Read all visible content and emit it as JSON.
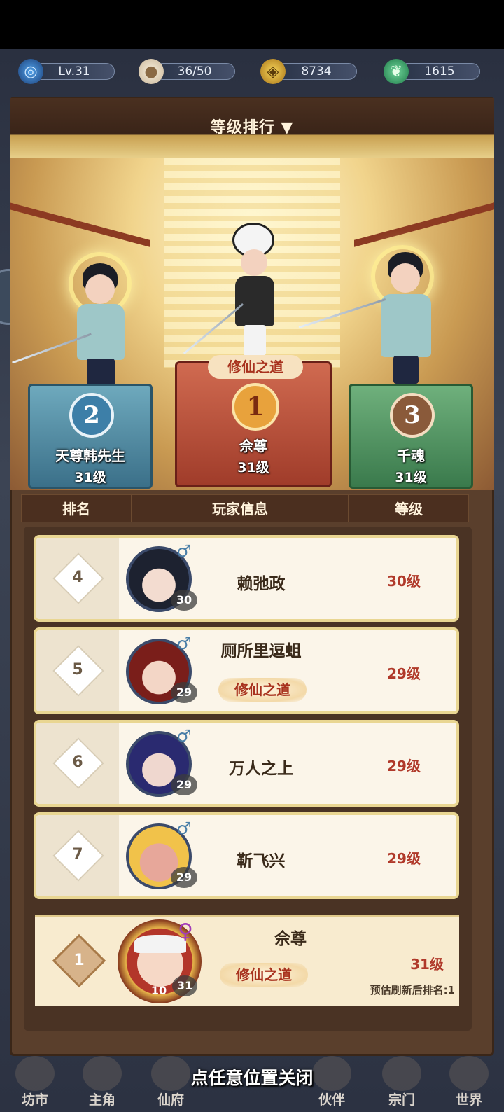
{
  "resources": {
    "level": "Lv.31",
    "stamina": "36/50",
    "coins": "8734",
    "jade": "1615"
  },
  "header": {
    "title": "等级排行 ▼"
  },
  "podium": [
    {
      "rank": "2",
      "name": "天尊韩先生",
      "level": "31级"
    },
    {
      "rank": "1",
      "name": "佘尊",
      "level": "31级",
      "badge": "修仙之道"
    },
    {
      "rank": "3",
      "name": "千魂",
      "level": "31级"
    }
  ],
  "table_headers": {
    "rank": "排名",
    "player": "玩家信息",
    "level": "等级"
  },
  "rows": [
    {
      "rank": "4",
      "name": "赖弛政",
      "avatar_level": "30",
      "level": "30级",
      "gender": "♂"
    },
    {
      "rank": "5",
      "name": "厕所里逗蛆",
      "avatar_level": "29",
      "level": "29级",
      "gender": "♂",
      "tag": "修仙之道"
    },
    {
      "rank": "6",
      "name": "万人之上",
      "avatar_level": "29",
      "level": "29级",
      "gender": "♂"
    },
    {
      "rank": "7",
      "name": "靳飞兴",
      "avatar_level": "29",
      "level": "29级",
      "gender": "♂"
    }
  ],
  "self": {
    "rank": "1",
    "name": "佘尊",
    "tag": "修仙之道",
    "avatar_level": "31",
    "vip_level": "10",
    "gender": "♀",
    "level": "31级",
    "prediction": "预估刷新后排名:1"
  },
  "nav": [
    "坊市",
    "主角",
    "仙府",
    "伙伴",
    "宗门",
    "世界"
  ],
  "close_hint": "点任意位置关闭"
}
